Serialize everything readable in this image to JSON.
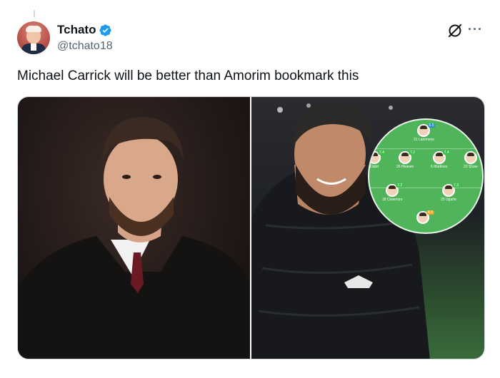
{
  "author": {
    "display_name": "Tchato",
    "handle": "@tchato18",
    "verified": true
  },
  "tweet": {
    "text": "Michael Carrick will be better than Amorim bookmark this"
  },
  "actions": {
    "more_label": "···"
  },
  "media": {
    "lineup": {
      "players": [
        {
          "label": "31 Lammens",
          "rating": "6.5"
        },
        {
          "label": "Dalot",
          "rating": "7.4"
        },
        {
          "label": "26 Heaven",
          "rating": "7.2"
        },
        {
          "label": "6 Martinez",
          "rating": "7.4"
        },
        {
          "label": "23 Shaw",
          "rating": ""
        },
        {
          "label": "18 Casemiro",
          "rating": "7.2"
        },
        {
          "label": "25 Ugarte",
          "rating": "7.3"
        },
        {
          "label": "",
          "rating": "6.8"
        }
      ]
    }
  },
  "colors": {
    "verified_blue": "#1d9bf0",
    "text_primary": "#0f1419",
    "text_secondary": "#536471",
    "pitch_green": "#4fb45a"
  }
}
